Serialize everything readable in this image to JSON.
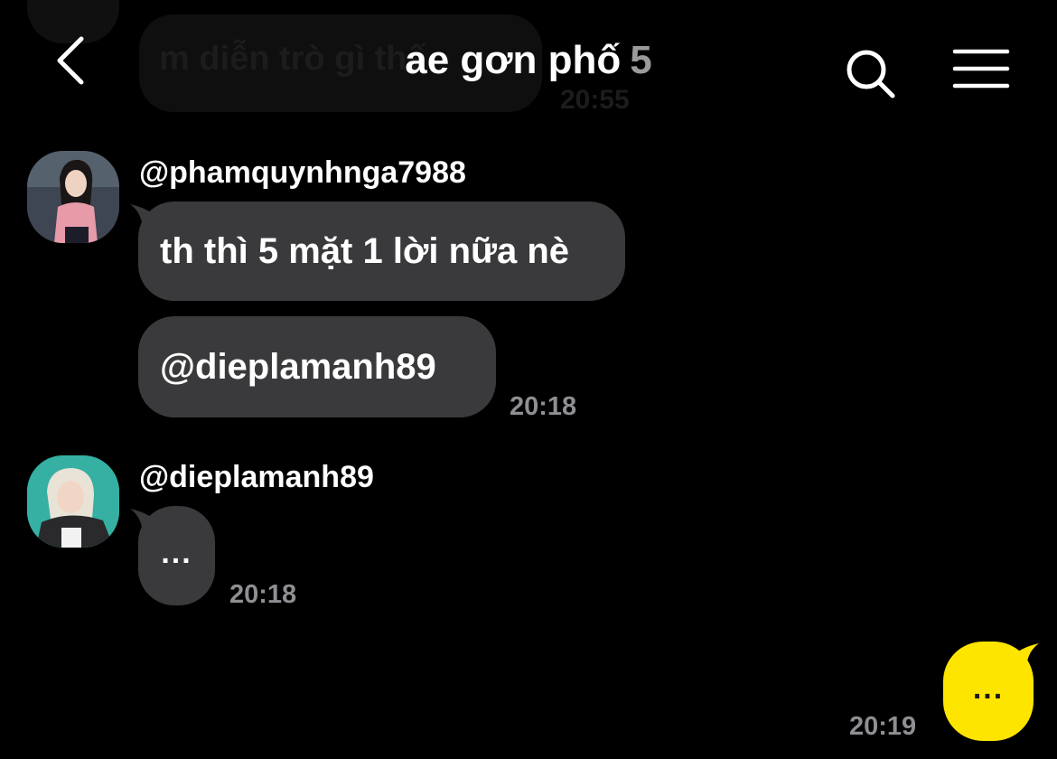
{
  "header": {
    "title": "ae gơn phố",
    "member_count": "5"
  },
  "background_message": {
    "text": "m diễn trò gì thế",
    "time": "20:55"
  },
  "messages": [
    {
      "sender": "@phamquynhnga7988",
      "bubbles": [
        "th thì 5 mặt 1 lời nữa nè",
        "@dieplamanh89"
      ],
      "time": "20:18"
    },
    {
      "sender": "@dieplamanh89",
      "bubbles": [
        "..."
      ],
      "time": "20:18"
    }
  ],
  "my_message": {
    "text": "...",
    "time": "20:19"
  },
  "icons": {
    "back": "chevron-left-icon",
    "search": "search-icon",
    "menu": "hamburger-menu-icon"
  },
  "colors": {
    "background": "#000000",
    "bubble_other": "#3a3a3c",
    "bubble_mine": "#fee500",
    "time_text": "#8e8e93",
    "member_count": "#9a9a9a"
  }
}
